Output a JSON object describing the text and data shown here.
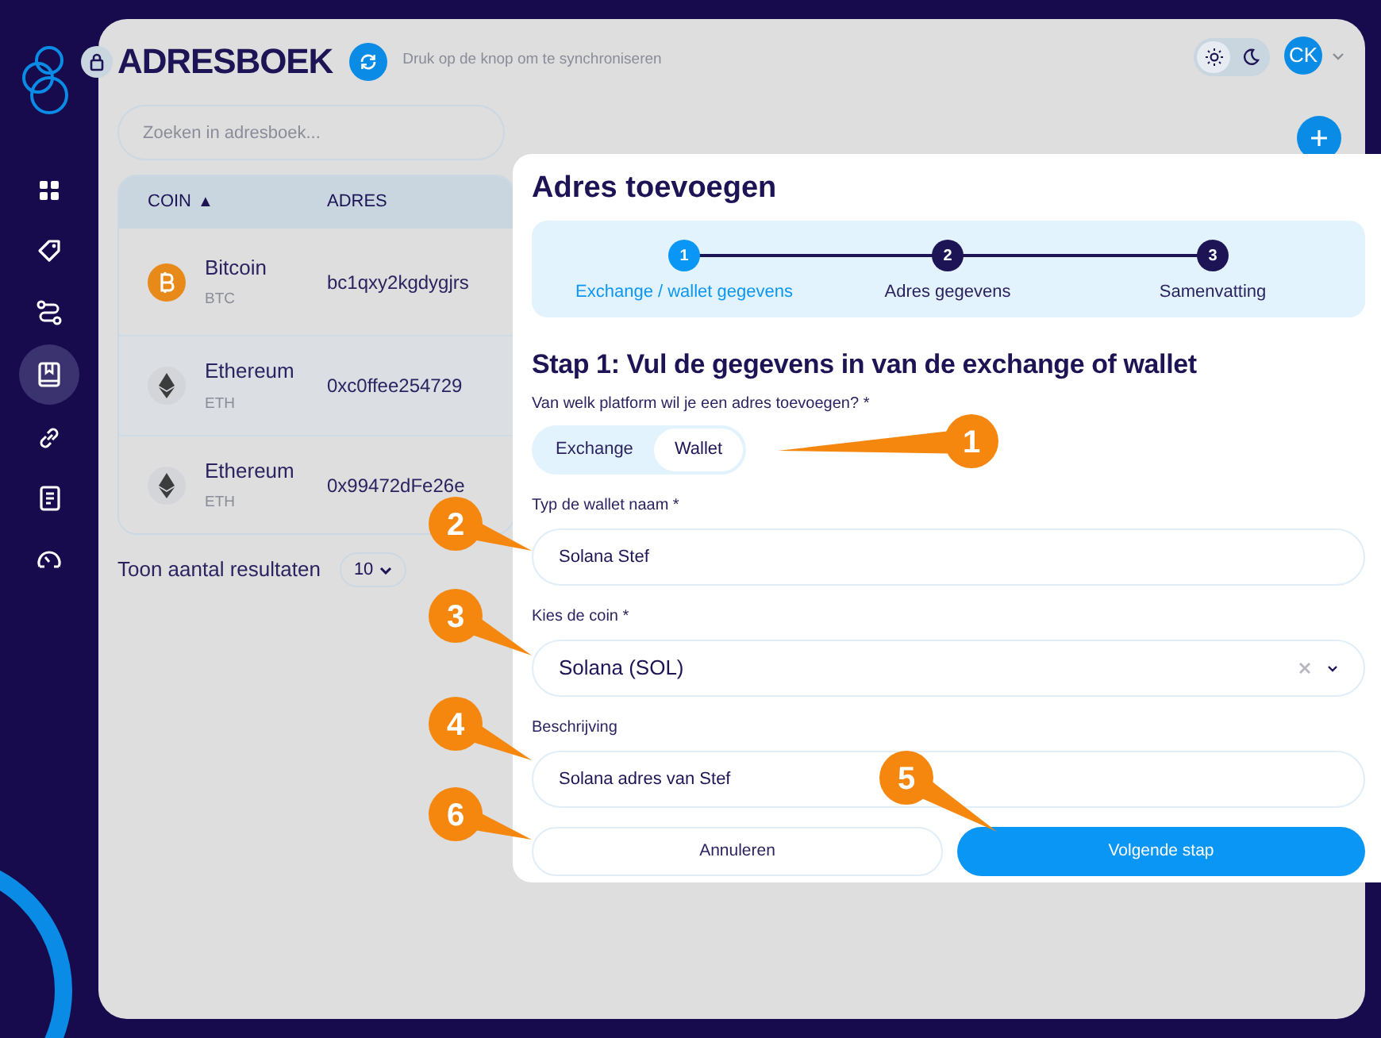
{
  "sidebar": {
    "items": [
      {
        "kind": "grid",
        "selected": false
      },
      {
        "kind": "tag",
        "selected": false
      },
      {
        "kind": "route",
        "selected": false
      },
      {
        "kind": "book",
        "selected": true
      },
      {
        "kind": "link",
        "selected": false
      },
      {
        "kind": "document",
        "selected": false
      },
      {
        "kind": "gauge",
        "selected": false
      }
    ]
  },
  "header": {
    "title": "ADRESBOEK",
    "sync_hint": "Druk op de knop om te synchroniseren",
    "theme_toggle": [
      {
        "kind": "light",
        "selected": true
      },
      {
        "kind": "dark",
        "selected": false
      }
    ],
    "user": {
      "initials": "CK"
    }
  },
  "search": {
    "placeholder": "Zoeken in adresboek..."
  },
  "table": {
    "columns": [
      {
        "label": "COIN",
        "sort_indicator": "▲"
      },
      {
        "label": "ADRES"
      }
    ],
    "rows": [
      {
        "kind": "bitcoin",
        "coin": "Bitcoin",
        "symbol": "BTC",
        "address": "bc1qxy2kgdygjrs"
      },
      {
        "kind": "ethereum",
        "coin": "Ethereum",
        "symbol": "ETH",
        "address": "0xc0ffee254729"
      },
      {
        "kind": "ethereum",
        "coin": "Ethereum",
        "symbol": "ETH",
        "address": "0x99472dFe26e"
      }
    ]
  },
  "pagination": {
    "label": "Toon aantal resultaten",
    "page_size": "10"
  },
  "modal": {
    "title": "Adres toevoegen",
    "steps": [
      {
        "number": "1",
        "label": "Exchange / wallet gegevens",
        "selected": true
      },
      {
        "number": "2",
        "label": "Adres gegevens",
        "selected": false
      },
      {
        "number": "3",
        "label": "Samenvatting",
        "selected": false
      }
    ],
    "step_heading": "Stap 1: Vul de gegevens in van de exchange of wallet",
    "platform": {
      "label": "Van welk platform wil je een adres toevoegen? *",
      "options": [
        {
          "label": "Exchange",
          "selected": false
        },
        {
          "label": "Wallet",
          "selected": true
        }
      ]
    },
    "fields": [
      {
        "kind": "text",
        "label": "Typ de wallet naam *",
        "value": "Solana Stef"
      },
      {
        "kind": "select",
        "label": "Kies de coin *",
        "value": "Solana (SOL)"
      },
      {
        "kind": "text",
        "label": "Beschrijving",
        "value": "Solana adres van Stef"
      }
    ],
    "buttons": [
      {
        "kind": "secondary",
        "label": "Annuleren"
      },
      {
        "kind": "primary",
        "label": "Volgende stap"
      }
    ]
  },
  "callouts": [
    {
      "label": "1"
    },
    {
      "label": "2"
    },
    {
      "label": "3"
    },
    {
      "label": "4"
    },
    {
      "label": "5"
    },
    {
      "label": "6"
    }
  ]
}
